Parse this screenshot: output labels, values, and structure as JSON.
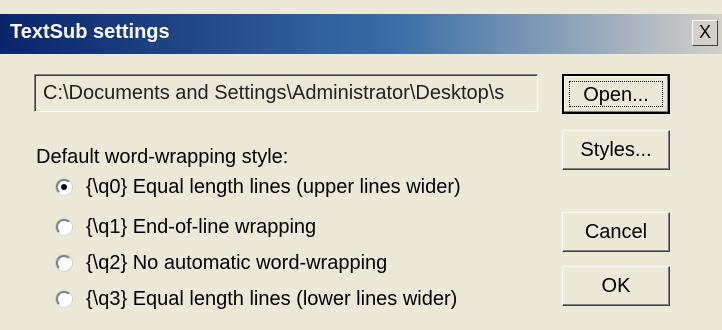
{
  "window": {
    "title": "TextSub settings",
    "close_label": "X"
  },
  "path_field": {
    "value": "C:\\Documents and Settings\\Administrator\\Desktop\\s"
  },
  "buttons": {
    "open": "Open...",
    "styles": "Styles...",
    "cancel": "Cancel",
    "ok": "OK"
  },
  "wrapping": {
    "label": "Default word-wrapping style:",
    "selected_index": 0,
    "options": [
      "{\\q0} Equal length lines (upper lines wider)",
      "{\\q1} End-of-line wrapping",
      "{\\q2} No automatic word-wrapping",
      "{\\q3} Equal length lines (lower lines wider)"
    ]
  }
}
